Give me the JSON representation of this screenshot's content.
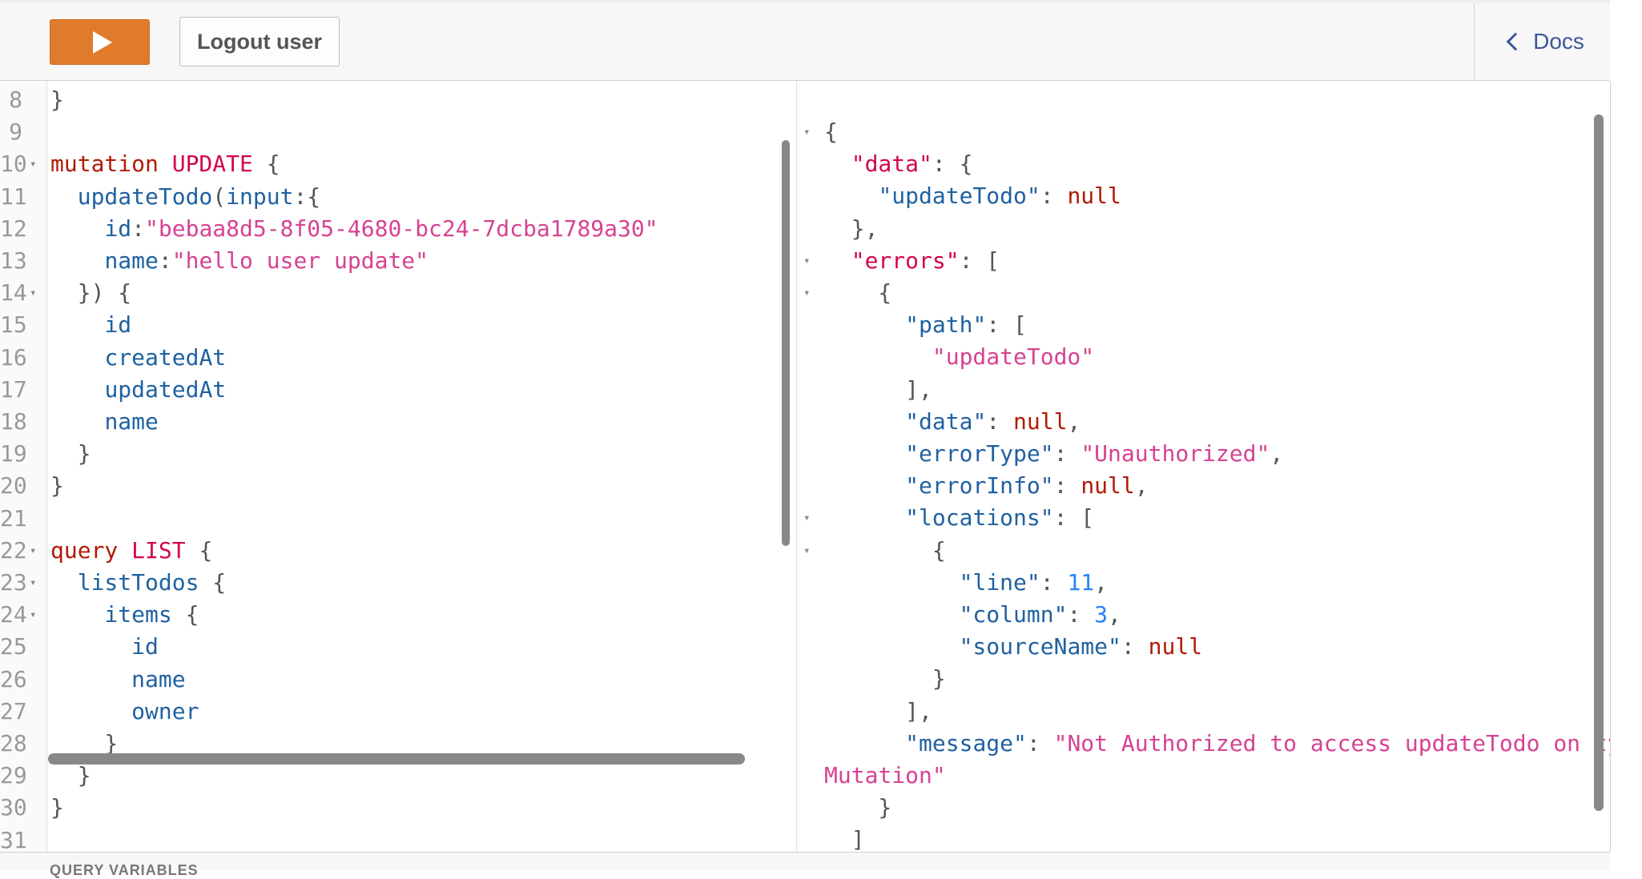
{
  "toolbar": {
    "run_icon": "play-icon",
    "logout_label": "Logout user",
    "docs_label": "Docs",
    "docs_icon": "chevron-left-icon"
  },
  "editor": {
    "lines": [
      {
        "n": "8",
        "fold": "",
        "code": [
          {
            "t": "}",
            "c": "punct"
          }
        ]
      },
      {
        "n": "9",
        "fold": "",
        "code": []
      },
      {
        "n": "10",
        "fold": "▾",
        "code": [
          {
            "t": "mutation",
            "c": "kw"
          },
          {
            "t": " ",
            "c": "punct"
          },
          {
            "t": "UPDATE",
            "c": "def"
          },
          {
            "t": " {",
            "c": "punct"
          }
        ]
      },
      {
        "n": "11",
        "fold": "",
        "code": [
          {
            "t": "  ",
            "c": "punct"
          },
          {
            "t": "updateTodo",
            "c": "fld"
          },
          {
            "t": "(",
            "c": "punct"
          },
          {
            "t": "input",
            "c": "attr"
          },
          {
            "t": ":{",
            "c": "punct"
          }
        ]
      },
      {
        "n": "12",
        "fold": "",
        "code": [
          {
            "t": "    ",
            "c": "punct"
          },
          {
            "t": "id",
            "c": "attr"
          },
          {
            "t": ":",
            "c": "punct"
          },
          {
            "t": "\"bebaa8d5-8f05-4680-bc24-7dcba1789a30\"",
            "c": "str"
          }
        ]
      },
      {
        "n": "13",
        "fold": "",
        "code": [
          {
            "t": "    ",
            "c": "punct"
          },
          {
            "t": "name",
            "c": "attr"
          },
          {
            "t": ":",
            "c": "punct"
          },
          {
            "t": "\"hello user update\"",
            "c": "str"
          }
        ]
      },
      {
        "n": "14",
        "fold": "▾",
        "code": [
          {
            "t": "  }) {",
            "c": "punct"
          }
        ]
      },
      {
        "n": "15",
        "fold": "",
        "code": [
          {
            "t": "    ",
            "c": "punct"
          },
          {
            "t": "id",
            "c": "fld"
          }
        ]
      },
      {
        "n": "16",
        "fold": "",
        "code": [
          {
            "t": "    ",
            "c": "punct"
          },
          {
            "t": "createdAt",
            "c": "fld"
          }
        ]
      },
      {
        "n": "17",
        "fold": "",
        "code": [
          {
            "t": "    ",
            "c": "punct"
          },
          {
            "t": "updatedAt",
            "c": "fld"
          }
        ]
      },
      {
        "n": "18",
        "fold": "",
        "code": [
          {
            "t": "    ",
            "c": "punct"
          },
          {
            "t": "name",
            "c": "fld"
          }
        ]
      },
      {
        "n": "19",
        "fold": "",
        "code": [
          {
            "t": "  }",
            "c": "punct"
          }
        ]
      },
      {
        "n": "20",
        "fold": "",
        "code": [
          {
            "t": "}",
            "c": "punct"
          }
        ]
      },
      {
        "n": "21",
        "fold": "",
        "code": []
      },
      {
        "n": "22",
        "fold": "▾",
        "code": [
          {
            "t": "query",
            "c": "kw"
          },
          {
            "t": " ",
            "c": "punct"
          },
          {
            "t": "LIST",
            "c": "def"
          },
          {
            "t": " {",
            "c": "punct"
          }
        ]
      },
      {
        "n": "23",
        "fold": "▾",
        "code": [
          {
            "t": "  ",
            "c": "punct"
          },
          {
            "t": "listTodos",
            "c": "fld"
          },
          {
            "t": " {",
            "c": "punct"
          }
        ]
      },
      {
        "n": "24",
        "fold": "▾",
        "code": [
          {
            "t": "    ",
            "c": "punct"
          },
          {
            "t": "items",
            "c": "fld"
          },
          {
            "t": " {",
            "c": "punct"
          }
        ]
      },
      {
        "n": "25",
        "fold": "",
        "code": [
          {
            "t": "      ",
            "c": "punct"
          },
          {
            "t": "id",
            "c": "fld"
          }
        ]
      },
      {
        "n": "26",
        "fold": "",
        "code": [
          {
            "t": "      ",
            "c": "punct"
          },
          {
            "t": "name",
            "c": "fld"
          }
        ]
      },
      {
        "n": "27",
        "fold": "",
        "code": [
          {
            "t": "      ",
            "c": "punct"
          },
          {
            "t": "owner",
            "c": "fld"
          }
        ]
      },
      {
        "n": "28",
        "fold": "",
        "code": [
          {
            "t": "    }",
            "c": "punct"
          }
        ]
      },
      {
        "n": "29",
        "fold": "",
        "code": [
          {
            "t": "  }",
            "c": "punct"
          }
        ]
      },
      {
        "n": "30",
        "fold": "",
        "code": [
          {
            "t": "}",
            "c": "punct"
          }
        ]
      },
      {
        "n": "31",
        "fold": "",
        "code": []
      }
    ]
  },
  "result": {
    "lines": [
      {
        "fold": "▾",
        "code": [
          {
            "t": "{",
            "c": "punct"
          }
        ]
      },
      {
        "fold": "",
        "code": [
          {
            "t": "  ",
            "c": "punct"
          },
          {
            "t": "\"data\"",
            "c": "def"
          },
          {
            "t": ": {",
            "c": "punct"
          }
        ]
      },
      {
        "fold": "",
        "code": [
          {
            "t": "    ",
            "c": "punct"
          },
          {
            "t": "\"updateTodo\"",
            "c": "keys"
          },
          {
            "t": ": ",
            "c": "punct"
          },
          {
            "t": "null",
            "c": "jnull"
          }
        ]
      },
      {
        "fold": "",
        "code": [
          {
            "t": "  },",
            "c": "punct"
          }
        ]
      },
      {
        "fold": "▾",
        "code": [
          {
            "t": "  ",
            "c": "punct"
          },
          {
            "t": "\"errors\"",
            "c": "def"
          },
          {
            "t": ": [",
            "c": "punct"
          }
        ]
      },
      {
        "fold": "▾",
        "code": [
          {
            "t": "    {",
            "c": "punct"
          }
        ]
      },
      {
        "fold": "",
        "code": [
          {
            "t": "      ",
            "c": "punct"
          },
          {
            "t": "\"path\"",
            "c": "keys"
          },
          {
            "t": ": [",
            "c": "punct"
          }
        ]
      },
      {
        "fold": "",
        "code": [
          {
            "t": "        ",
            "c": "punct"
          },
          {
            "t": "\"updateTodo\"",
            "c": "jstr"
          }
        ]
      },
      {
        "fold": "",
        "code": [
          {
            "t": "      ],",
            "c": "punct"
          }
        ]
      },
      {
        "fold": "",
        "code": [
          {
            "t": "      ",
            "c": "punct"
          },
          {
            "t": "\"data\"",
            "c": "keys"
          },
          {
            "t": ": ",
            "c": "punct"
          },
          {
            "t": "null",
            "c": "jnull"
          },
          {
            "t": ",",
            "c": "punct"
          }
        ]
      },
      {
        "fold": "",
        "code": [
          {
            "t": "      ",
            "c": "punct"
          },
          {
            "t": "\"errorType\"",
            "c": "keys"
          },
          {
            "t": ": ",
            "c": "punct"
          },
          {
            "t": "\"Unauthorized\"",
            "c": "jstr"
          },
          {
            "t": ",",
            "c": "punct"
          }
        ]
      },
      {
        "fold": "",
        "code": [
          {
            "t": "      ",
            "c": "punct"
          },
          {
            "t": "\"errorInfo\"",
            "c": "keys"
          },
          {
            "t": ": ",
            "c": "punct"
          },
          {
            "t": "null",
            "c": "jnull"
          },
          {
            "t": ",",
            "c": "punct"
          }
        ]
      },
      {
        "fold": "▾",
        "code": [
          {
            "t": "      ",
            "c": "punct"
          },
          {
            "t": "\"locations\"",
            "c": "keys"
          },
          {
            "t": ": [",
            "c": "punct"
          }
        ]
      },
      {
        "fold": "▾",
        "code": [
          {
            "t": "        {",
            "c": "punct"
          }
        ]
      },
      {
        "fold": "",
        "code": [
          {
            "t": "          ",
            "c": "punct"
          },
          {
            "t": "\"line\"",
            "c": "keys"
          },
          {
            "t": ": ",
            "c": "punct"
          },
          {
            "t": "11",
            "c": "jnum"
          },
          {
            "t": ",",
            "c": "punct"
          }
        ]
      },
      {
        "fold": "",
        "code": [
          {
            "t": "          ",
            "c": "punct"
          },
          {
            "t": "\"column\"",
            "c": "keys"
          },
          {
            "t": ": ",
            "c": "punct"
          },
          {
            "t": "3",
            "c": "jnum"
          },
          {
            "t": ",",
            "c": "punct"
          }
        ]
      },
      {
        "fold": "",
        "code": [
          {
            "t": "          ",
            "c": "punct"
          },
          {
            "t": "\"sourceName\"",
            "c": "keys"
          },
          {
            "t": ": ",
            "c": "punct"
          },
          {
            "t": "null",
            "c": "jnull"
          }
        ]
      },
      {
        "fold": "",
        "code": [
          {
            "t": "        }",
            "c": "punct"
          }
        ]
      },
      {
        "fold": "",
        "code": [
          {
            "t": "      ],",
            "c": "punct"
          }
        ]
      },
      {
        "fold": "",
        "code": [
          {
            "t": "      ",
            "c": "punct"
          },
          {
            "t": "\"message\"",
            "c": "keys"
          },
          {
            "t": ": ",
            "c": "punct"
          },
          {
            "t": "\"Not Authorized to access updateTodo on type",
            "c": "jstr"
          }
        ]
      },
      {
        "fold": "",
        "code": [
          {
            "t": "Mutation\"",
            "c": "jstr"
          }
        ]
      },
      {
        "fold": "",
        "code": [
          {
            "t": "    }",
            "c": "punct"
          }
        ]
      },
      {
        "fold": "",
        "code": [
          {
            "t": "  ]",
            "c": "punct"
          }
        ]
      }
    ]
  },
  "bottom": {
    "label": "QUERY VARIABLES"
  },
  "colors": {
    "run_button": "#e07b2c",
    "keyword": "#b11a04",
    "definition": "#d2054e",
    "field": "#1f61a0",
    "string": "#d64292",
    "number": "#2882f9"
  }
}
